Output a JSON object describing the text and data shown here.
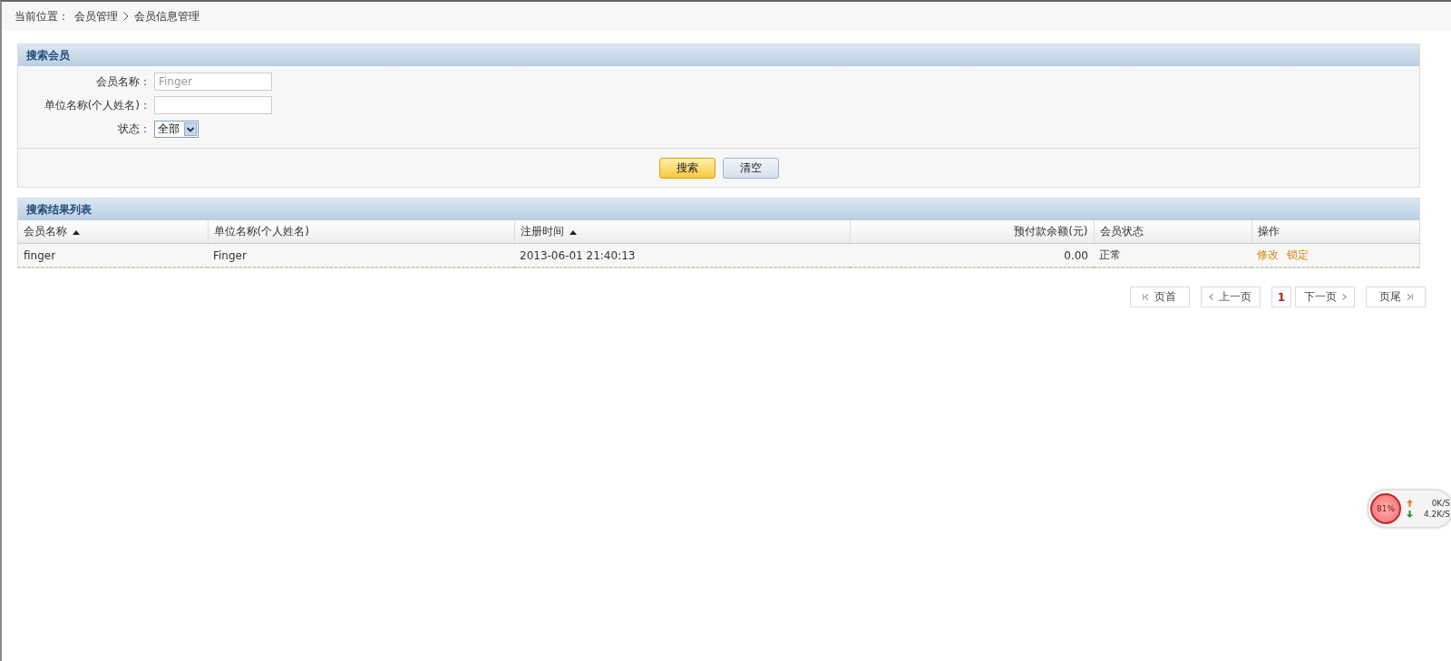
{
  "breadcrumb": {
    "label": "当前位置：",
    "path": [
      "会员管理",
      "会员信息管理"
    ]
  },
  "search_panel": {
    "title": "搜索会员",
    "fields": [
      {
        "kind": "text",
        "label": "会员名称：",
        "placeholder": "Finger"
      },
      {
        "kind": "text",
        "label": "单位名称(个人姓名)："
      },
      {
        "kind": "select",
        "label": "状态：",
        "value": "全部"
      }
    ],
    "buttons": [
      {
        "label": "搜索",
        "primary": true
      },
      {
        "label": "清空",
        "primary": false
      }
    ]
  },
  "results_panel": {
    "title": "搜索结果列表",
    "columns": [
      {
        "label": "会员名称",
        "sortable": true,
        "kind": "text"
      },
      {
        "label": "单位名称(个人姓名)",
        "sortable": false,
        "kind": "text"
      },
      {
        "label": "注册时间",
        "sortable": true,
        "kind": "text"
      },
      {
        "label": "预付款余额(元)",
        "sortable": false,
        "kind": "amount"
      },
      {
        "label": "会员状态",
        "sortable": false,
        "kind": "text"
      },
      {
        "label": "操作",
        "sortable": false,
        "kind": "text"
      }
    ],
    "rows": [
      {
        "cells": [
          "finger",
          "Finger",
          "2013-06-01 21:40:13",
          "0.00",
          "正常"
        ],
        "actions": [
          "修改",
          "锁定"
        ]
      }
    ]
  },
  "pagination": [
    {
      "kind": "first",
      "label": "页首"
    },
    {
      "kind": "prev",
      "label": "上一页"
    },
    {
      "kind": "current",
      "label": "1"
    },
    {
      "kind": "next",
      "label": "下一页"
    },
    {
      "kind": "last",
      "label": "页尾"
    }
  ],
  "speed_widget": {
    "percent": "81%",
    "upload": "0K/S",
    "download": "4.2K/S"
  }
}
